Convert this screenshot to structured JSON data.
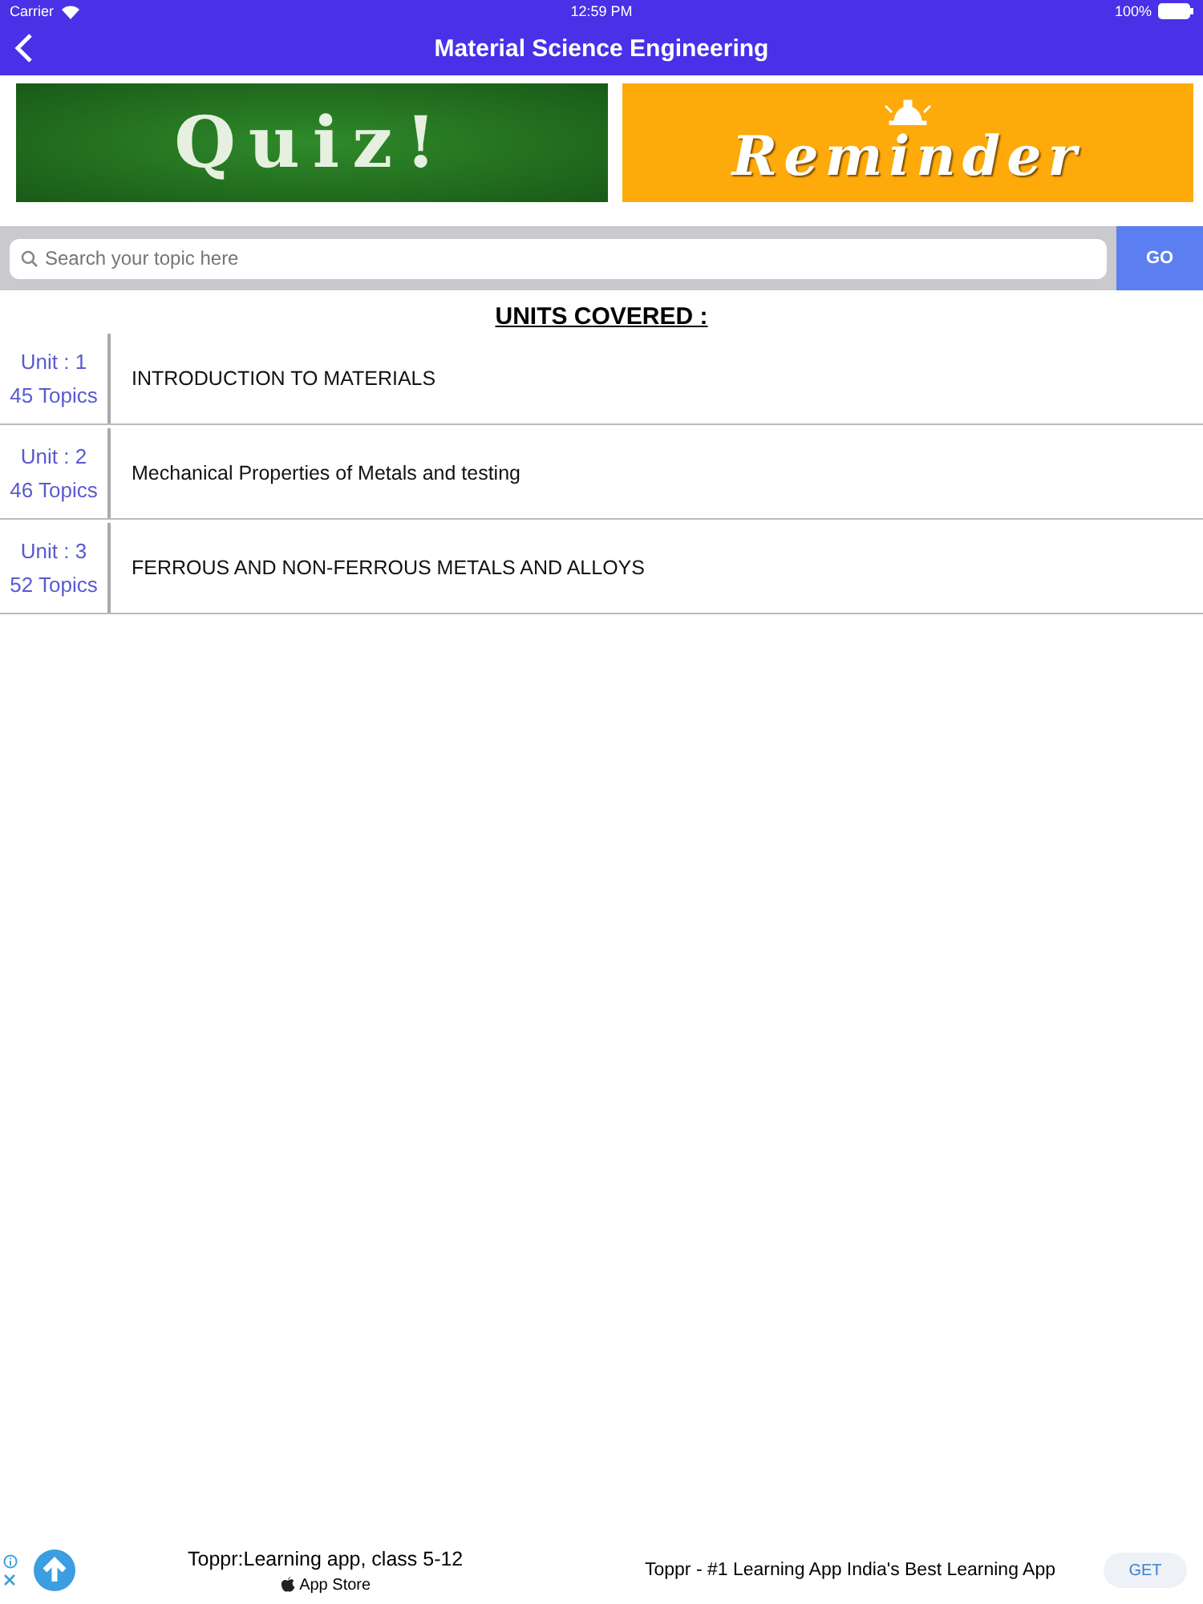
{
  "status_bar": {
    "carrier": "Carrier",
    "time": "12:59 PM",
    "battery": "100%"
  },
  "nav": {
    "title": "Material Science Engineering"
  },
  "banners": [
    {
      "kind": "quiz",
      "label": "Quiz!"
    },
    {
      "kind": "reminder",
      "label": "Reminder"
    }
  ],
  "search": {
    "placeholder": "Search your topic here",
    "button": "GO"
  },
  "heading": "UNITS COVERED :",
  "units": [
    {
      "unit": "Unit : 1",
      "topics": "45 Topics",
      "title": "INTRODUCTION TO MATERIALS"
    },
    {
      "unit": "Unit : 2",
      "topics": "46 Topics",
      "title": "Mechanical Properties of Metals and testing"
    },
    {
      "unit": "Unit : 3",
      "topics": "52 Topics",
      "title": "FERROUS AND NON-FERROUS METALS AND ALLOYS"
    }
  ],
  "ad": {
    "title": "Toppr:Learning app, class 5-12",
    "store": "App Store",
    "tagline": "Toppr - #1 Learning App India's Best Learning App",
    "button": "GET"
  }
}
